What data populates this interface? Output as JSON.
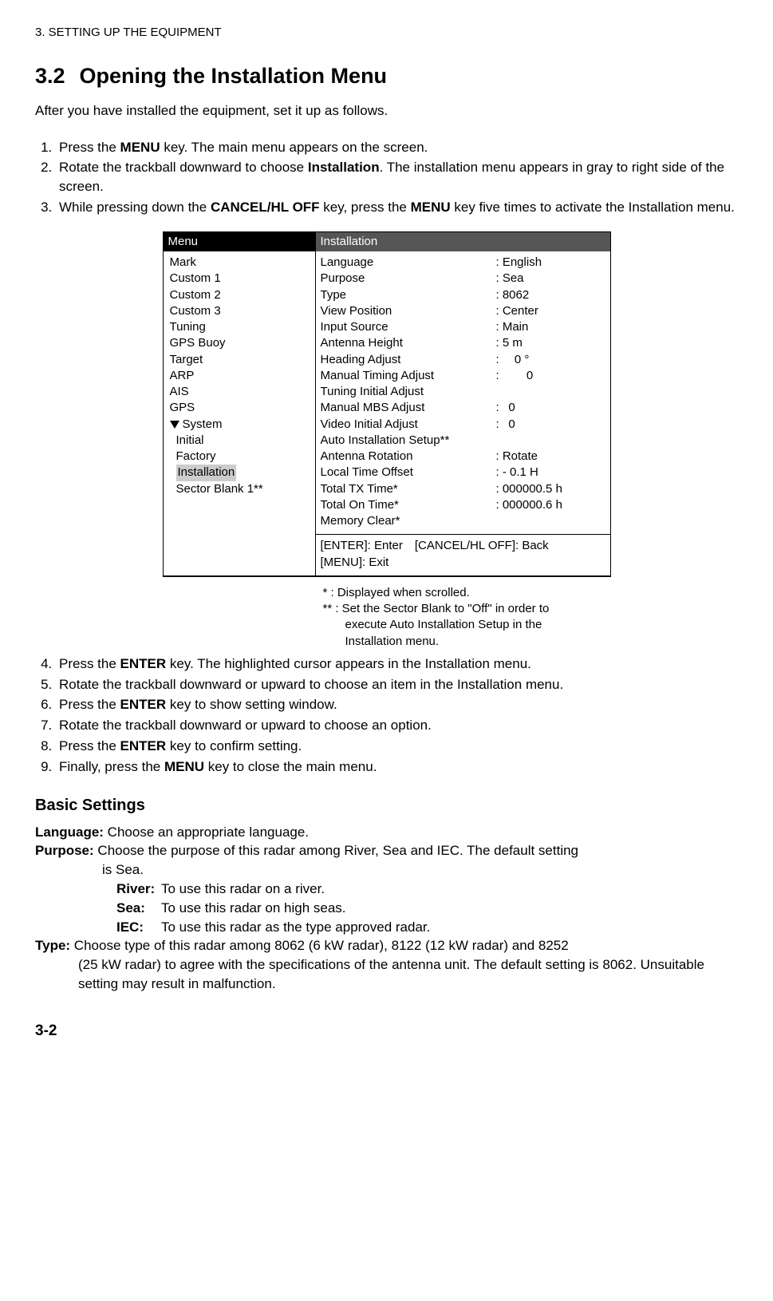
{
  "chapter_line": "3. SETTING UP THE EQUIPMENT",
  "section_number": "3.2",
  "section_title": "Opening the Installation Menu",
  "intro": "After you have installed the equipment, set it up as follows.",
  "step1_a": "Press the ",
  "step1_b": "MENU",
  "step1_c": " key. The main menu appears on the screen.",
  "step2_a": "Rotate the trackball downward to choose ",
  "step2_b": "Installation",
  "step2_c": ". The installation menu appears in gray to right side of the screen.",
  "step3_a": "While pressing down the ",
  "step3_b": "CANCEL/HL OFF",
  "step3_c": " key, press the ",
  "step3_d": "MENU",
  "step3_e": " key five times to activate the Installation menu.",
  "menu_header": "Menu",
  "install_header": "Installation",
  "menu": {
    "m0": "Mark",
    "m1": "Custom 1",
    "m2": "Custom 2",
    "m3": "Custom 3",
    "m4": "Tuning",
    "m5": "GPS Buoy",
    "m6": "Target",
    "m7": "ARP",
    "m8": "AIS",
    "m9": "GPS",
    "m10": "System",
    "m11": "Initial",
    "m12": "Factory",
    "m13": "Installation",
    "m14": "Sector Blank 1**"
  },
  "rows": {
    "r0k": "Language",
    "r0v": ": English",
    "r1k": "Purpose",
    "r1v": ": Sea",
    "r2k": "Type",
    "r2v": ": 8062",
    "r3k": "View Position",
    "r3v": ": Center",
    "r4k": "Input Source",
    "r4v": ": Main",
    "r5k": "Antenna Height",
    "r5v": ": 5 m",
    "r6k": "Heading Adjust",
    "r6v": ":  0 °",
    "r7k": "Manual Timing Adjust",
    "r7v": ":   0",
    "r8k": "Tuning Initial Adjust",
    "r8v": "",
    "r9k": "Manual MBS Adjust",
    "r9v": ":  0",
    "r10k": "Video Initial Adjust",
    "r10v": ":  0",
    "r11k": "Auto Installation Setup**",
    "r11v": "",
    "r12k": "Antenna Rotation",
    "r12v": ": Rotate",
    "r13k": "Local Time Offset",
    "r13v": ": - 0.1 H",
    "r14k": "Total TX Time*",
    "r14v": ": 000000.5 h",
    "r15k": "Total On Time*",
    "r15v": ": 000000.6 h",
    "r16k": "Memory Clear*",
    "r16v": ""
  },
  "footer_line1": "[ENTER]: Enter [CANCEL/HL OFF]: Back",
  "footer_line2": "[MENU]: Exit",
  "fn1": "* : Displayed when scrolled.",
  "fn2": "** : Set the Sector Blank to \"Off\" in order to",
  "fn2b": "execute Auto Installation Setup in  the",
  "fn2c": "Installation menu.",
  "step4_a": "Press the ",
  "step4_b": "ENTER",
  "step4_c": " key. The highlighted cursor appears in the Installation menu.",
  "step5": "Rotate the trackball downward or upward to choose an item in the Installation menu.",
  "step6_a": "Press the ",
  "step6_b": "ENTER",
  "step6_c": " key to show setting window.",
  "step7": "Rotate the trackball downward or upward to choose an option.",
  "step8_a": "Press the ",
  "step8_b": "ENTER",
  "step8_c": " key to confirm setting.",
  "step9_a": "Finally, press the ",
  "step9_b": "MENU",
  "step9_c": " key to close the main menu.",
  "basic_heading": "Basic Settings",
  "lang_label": "Language:",
  "lang_text": " Choose an appropriate language.",
  "purpose_label": "Purpose:",
  "purpose_text": " Choose the purpose of this radar among River, Sea and IEC. The default setting",
  "purpose_text2": "is Sea.",
  "river_label": "River:",
  "river_text": "To use this radar on a river.",
  "sea_label": "Sea:",
  "sea_text": "To use this radar on high seas.",
  "iec_label": "IEC:",
  "iec_text": "To use this radar as the type approved radar.",
  "type_label": "Type:",
  "type_text": " Choose type of this radar among 8062 (6 kW radar), 8122 (12 kW radar) and 8252",
  "type_text2": "(25 kW radar) to agree with the specifications of the antenna unit. The default setting is 8062. Unsuitable setting may result in malfunction.",
  "page_num": "3-2"
}
